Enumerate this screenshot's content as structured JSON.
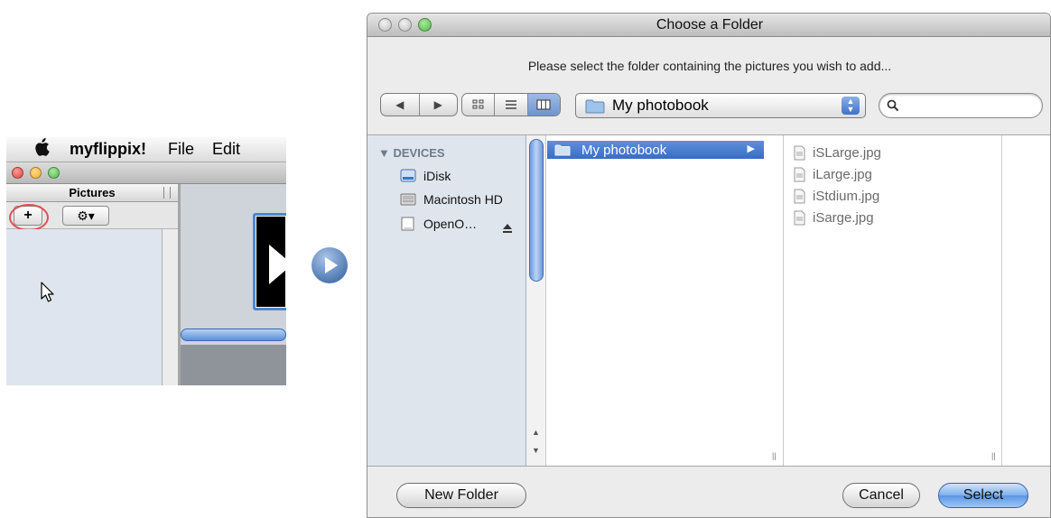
{
  "app": {
    "menu": {
      "app_name": "myflippix!",
      "items": [
        "File",
        "Edit"
      ]
    },
    "pictures_header": "Pictures",
    "add_label": "+",
    "action_label": "⚙▾"
  },
  "dialog": {
    "title": "Choose a Folder",
    "prompt": "Please select the folder containing the pictures you wish to add...",
    "location": "My photobook",
    "search": {
      "value": "",
      "placeholder": ""
    },
    "sidebar": {
      "header": "DEVICES",
      "items": [
        {
          "label": "iDisk",
          "icon": "idisk-icon"
        },
        {
          "label": "Macintosh HD",
          "icon": "hard-drive-icon"
        },
        {
          "label": "OpenO…",
          "icon": "disk-image-icon"
        }
      ]
    },
    "column1": {
      "selected": "My photobook"
    },
    "files": [
      "iSLarge.jpg",
      "iLarge.jpg",
      "iStdium.jpg",
      "iSarge.jpg"
    ],
    "buttons": {
      "new_folder": "New Folder",
      "cancel": "Cancel",
      "select": "Select"
    }
  },
  "colors": {
    "selection": "#3a6cc7",
    "default_button": "#5b95e3",
    "close": "#e0443e",
    "minimize": "#f5b12b",
    "zoom": "#52b94a"
  }
}
